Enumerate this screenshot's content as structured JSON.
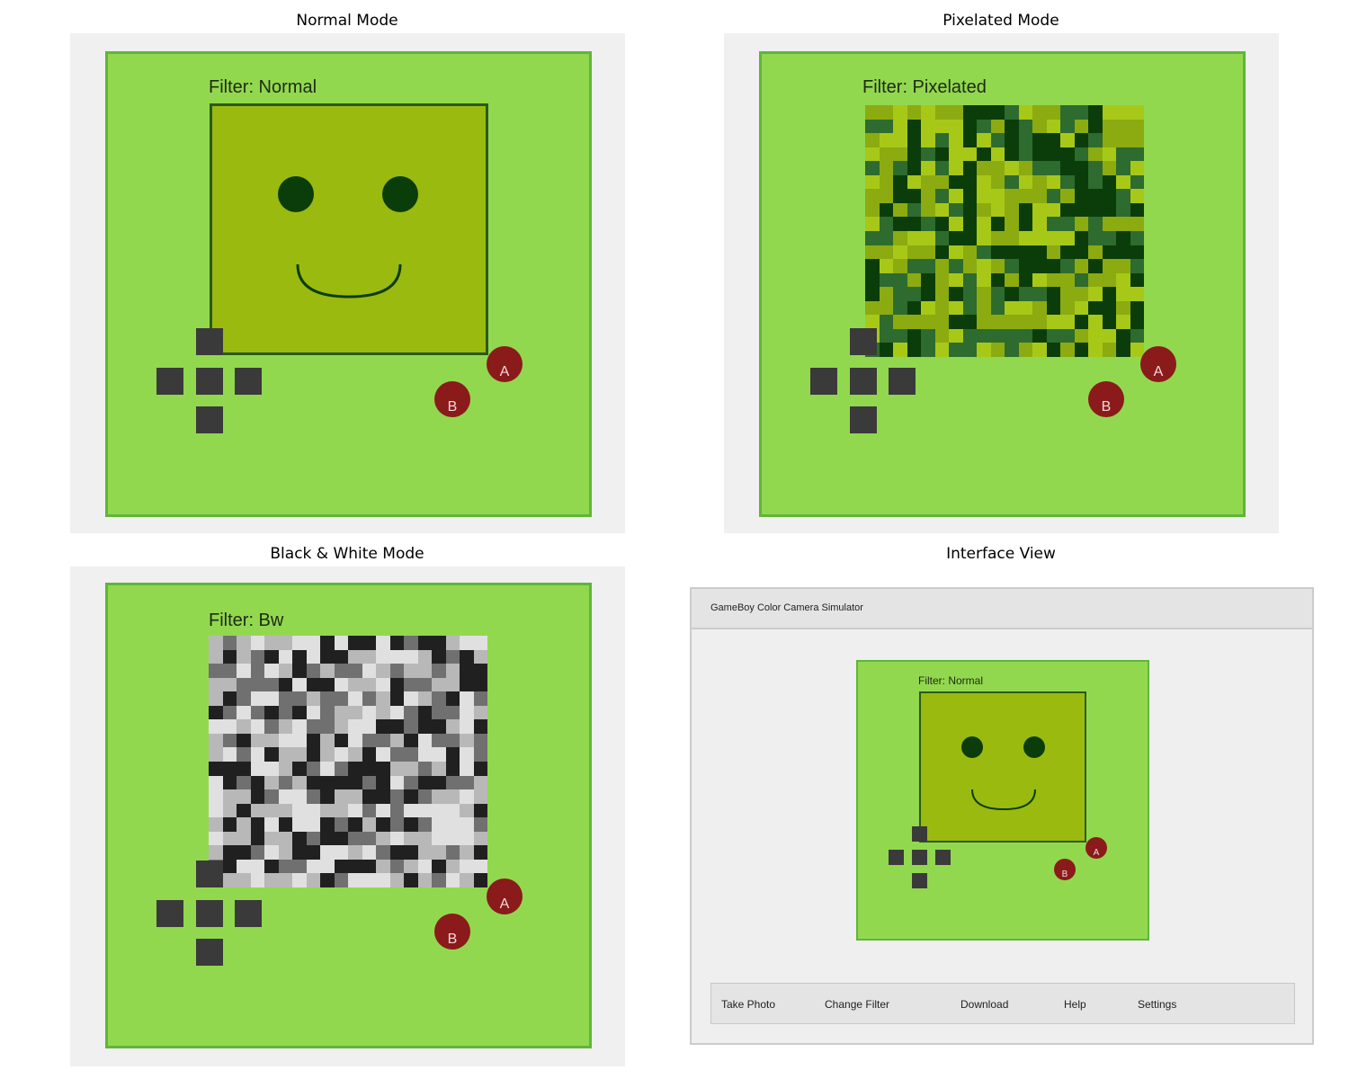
{
  "panels": [
    {
      "title": "Normal Mode",
      "filter_label": "Filter: Normal",
      "mode": "normal"
    },
    {
      "title": "Pixelated Mode",
      "filter_label": "Filter: Pixelated",
      "mode": "pixelated"
    },
    {
      "title": "Black & White Mode",
      "filter_label": "Filter: Bw",
      "mode": "bw"
    },
    {
      "title": "Interface View",
      "filter_label": "Filter: Normal",
      "mode": "normal"
    }
  ],
  "buttons": {
    "a": "A",
    "b": "B"
  },
  "app": {
    "window_title": "GameBoy Color Camera Simulator",
    "menu": [
      "Take Photo",
      "Change Filter",
      "Download",
      "Help",
      "Settings"
    ]
  },
  "colors": {
    "device_body": "#92d84f",
    "device_border": "#60b53a",
    "screen_normal": "#9aba10",
    "face_features": "#0b3d0b",
    "pixel_palette": [
      "#0b3d0b",
      "#2e6b2e",
      "#8cab10",
      "#a8c818"
    ],
    "bw_palette": [
      "#202020",
      "#707070",
      "#b8b8b8",
      "#e0e0e0"
    ],
    "dpad": "#3a3a3a",
    "action_button": "#8b1a1a"
  }
}
